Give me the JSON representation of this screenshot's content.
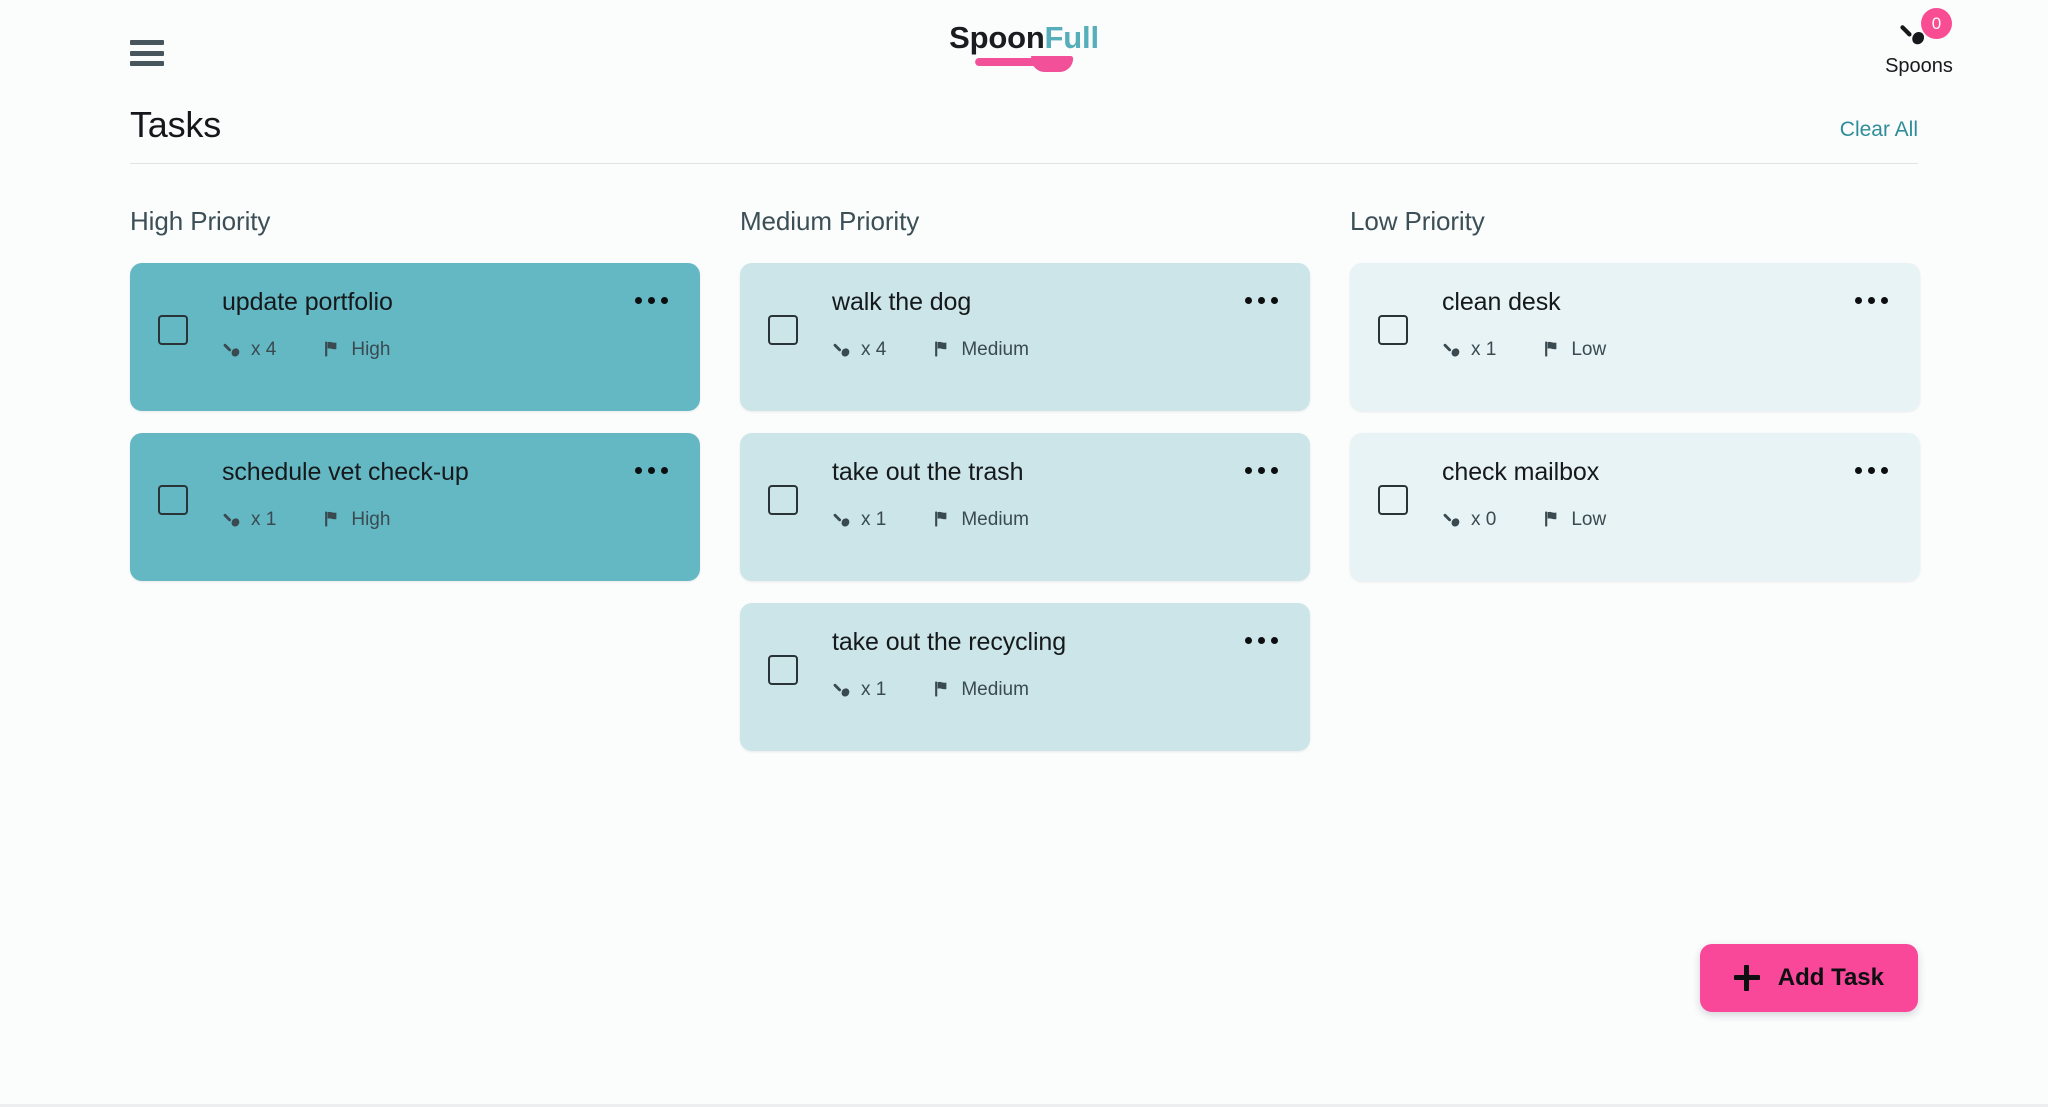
{
  "brand": {
    "name_part1": "Spoon",
    "name_part2": "Full"
  },
  "topbar": {
    "menu_icon": "hamburger-menu-icon",
    "spoons": {
      "icon": "spoon-icon",
      "count": "0",
      "label": "Spoons"
    }
  },
  "header": {
    "title": "Tasks",
    "clear_all_label": "Clear All"
  },
  "fab": {
    "icon": "plus-icon",
    "label": "Add Task"
  },
  "icons": {
    "spoon": "spoon-icon",
    "flag": "flag-icon",
    "overflow": "overflow-menu-icon",
    "checkbox": "checkbox-icon"
  },
  "columns": [
    {
      "id": "high",
      "title": "High Priority",
      "priority_label": "High",
      "color": "#63b8c4",
      "tasks": [
        {
          "title": "update portfolio",
          "spoons": "x 4",
          "priority": "High"
        },
        {
          "title": "schedule vet check-up",
          "spoons": "x 1",
          "priority": "High"
        }
      ]
    },
    {
      "id": "medium",
      "title": "Medium Priority",
      "priority_label": "Medium",
      "color": "#cbe5e9",
      "tasks": [
        {
          "title": "walk the dog",
          "spoons": "x 4",
          "priority": "Medium"
        },
        {
          "title": "take out the trash",
          "spoons": "x 1",
          "priority": "Medium"
        },
        {
          "title": "take out the recycling",
          "spoons": "x 1",
          "priority": "Medium"
        }
      ]
    },
    {
      "id": "low",
      "title": "Low Priority",
      "priority_label": "Low",
      "color": "#e8f3f5",
      "tasks": [
        {
          "title": "clean desk",
          "spoons": "x 1",
          "priority": "Low"
        },
        {
          "title": "check mailbox",
          "spoons": "x 0",
          "priority": "Low"
        }
      ]
    }
  ],
  "colors": {
    "accent_pink": "#f9479a",
    "accent_teal": "#56aebb",
    "link_teal": "#2f8d99",
    "page_bg": "#fbfcfc"
  }
}
